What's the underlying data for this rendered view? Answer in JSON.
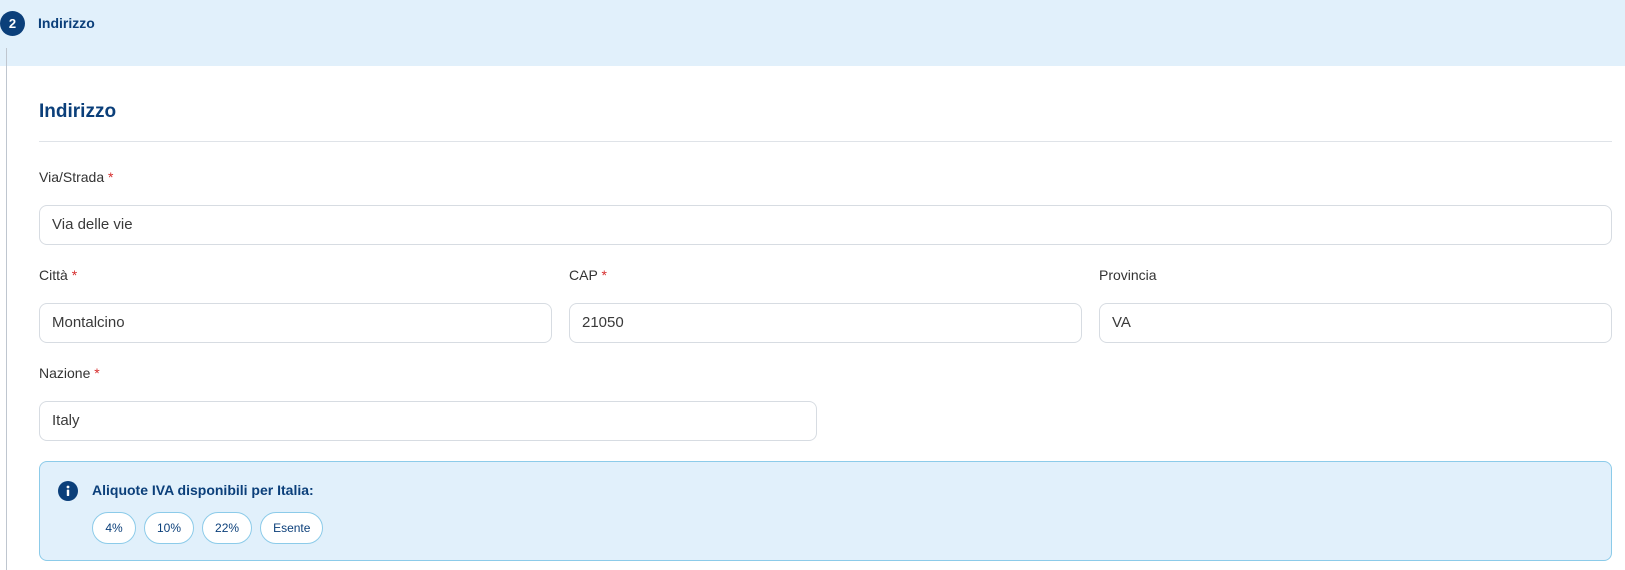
{
  "step": {
    "number": "2",
    "title": "Indirizzo"
  },
  "section": {
    "title": "Indirizzo"
  },
  "fields": {
    "street": {
      "label": "Via/Strada",
      "required_mark": "*",
      "value": "Via delle vie"
    },
    "city": {
      "label": "Città",
      "required_mark": "*",
      "value": "Montalcino"
    },
    "cap": {
      "label": "CAP",
      "required_mark": "*",
      "value": "21050"
    },
    "province": {
      "label": "Provincia",
      "value": "VA"
    },
    "country": {
      "label": "Nazione",
      "required_mark": "*",
      "value": "Italy"
    }
  },
  "vat_info": {
    "title": "Aliquote IVA disponibili per Italia:",
    "icon": "info-icon",
    "rates": [
      "4%",
      "10%",
      "22%",
      "Esente"
    ]
  },
  "colors": {
    "primary": "#0b3f7a",
    "header_bg": "#e1f0fb",
    "required": "#d62d2d",
    "info_border": "#8ccbe9"
  }
}
